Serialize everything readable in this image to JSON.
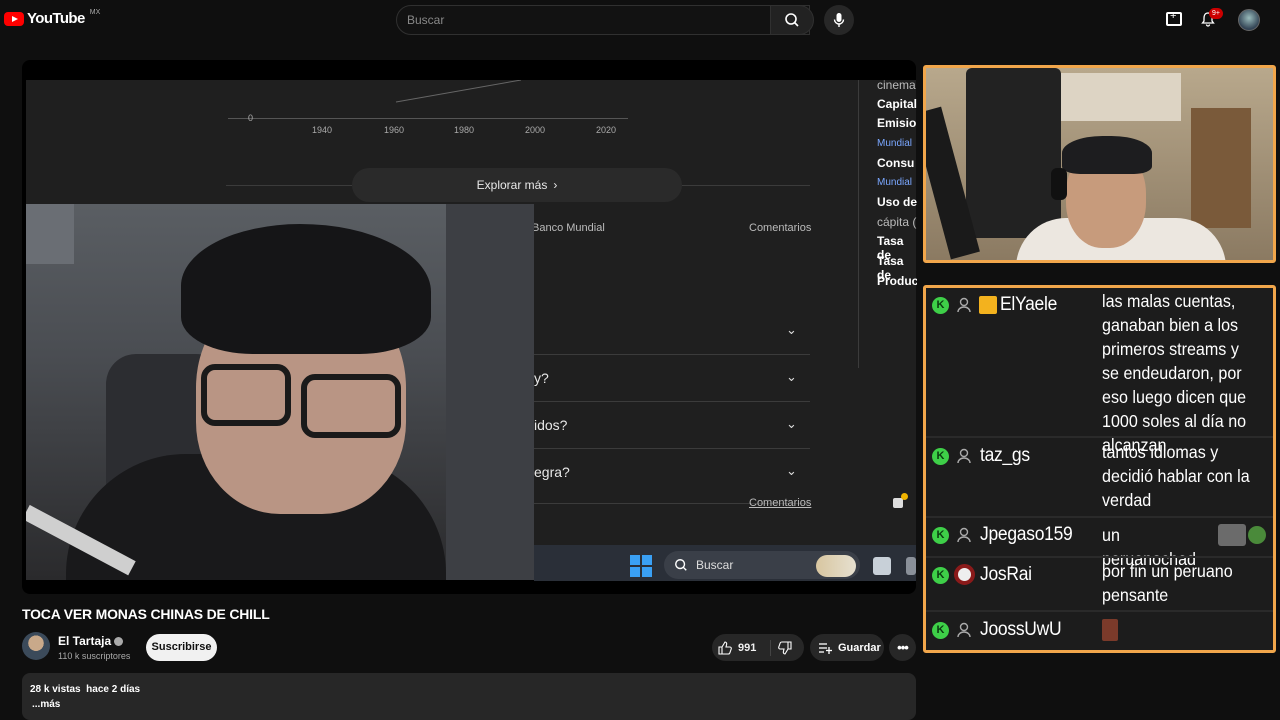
{
  "app": {
    "logo_text": "YouTube",
    "region": "MX",
    "search_placeholder": "Buscar",
    "notification_badge": "9+"
  },
  "player": {
    "chart_ticks": [
      "0",
      "1940",
      "1960",
      "1980",
      "2000",
      "2020"
    ],
    "explore_label": "Explorar más",
    "source_label": "Banco Mundial",
    "comments_label": "Comentarios",
    "comments_link": "Comentarios",
    "faq_items": [
      "y?",
      "idos?",
      "egra?"
    ],
    "right_col": {
      "cinema": "cinema",
      "capital": "Capital",
      "emision": "Emisio",
      "mundial1": "Mundial",
      "consumo": "Consu",
      "mundial2": "Mundial",
      "uso": "Uso de",
      "capita": "cápita (",
      "tasa1": "Tasa de",
      "tasa2": "Tasa de",
      "produ": "Produc"
    },
    "taskbar_search": "Buscar"
  },
  "chat": {
    "messages": [
      {
        "user": "ElYaele",
        "text": "las malas cuentas, ganaban bien a los primeros streams y se endeudaron, por eso luego dicen que 1000 soles al día no alcanzan"
      },
      {
        "user": "taz_gs",
        "text": "tantos idiomas y decidió hablar con la verdad"
      },
      {
        "user": "Jpegaso159",
        "text": "un peruanochad"
      },
      {
        "user": "JosRai",
        "text": "por fin un peruano pensante"
      },
      {
        "user": "JoossUwU",
        "text": ""
      }
    ],
    "kick_icon_label": "K"
  },
  "video": {
    "title": "TOCA VER MONAS CHINAS DE CHILL",
    "channel": "El Tartaja",
    "subscribers": "110 k suscriptores",
    "subscribe_label": "Suscribirse",
    "likes": "991",
    "save_label": "Guardar",
    "views": "28 k vistas",
    "age": "hace 2 días",
    "more": "...más"
  },
  "colors": {
    "accent_orange": "#f1a64b",
    "kick_green": "#3ecf48",
    "youtube_red": "#ff0000"
  }
}
